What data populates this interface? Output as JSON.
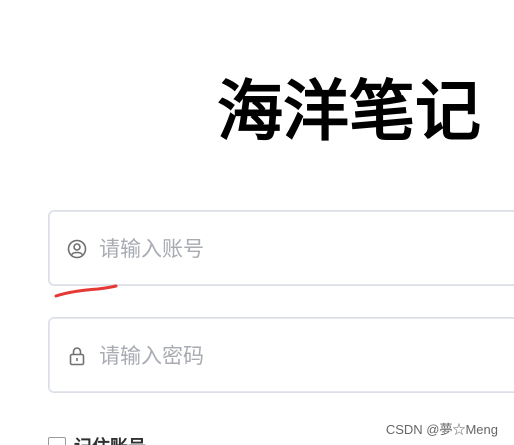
{
  "app": {
    "title": "海洋笔记"
  },
  "login_form": {
    "username": {
      "placeholder": "请输入账号",
      "value": "",
      "icon": "user-icon"
    },
    "password": {
      "placeholder": "请输入密码",
      "value": "",
      "icon": "lock-icon"
    },
    "remember": {
      "label": "记住账号"
    }
  },
  "watermark": {
    "text": "CSDN @夢☆Meng"
  },
  "colors": {
    "annotation_mark": "#e53935",
    "field_border": "#dcdfe6",
    "placeholder": "#a8abb2",
    "icon": "#707070"
  }
}
